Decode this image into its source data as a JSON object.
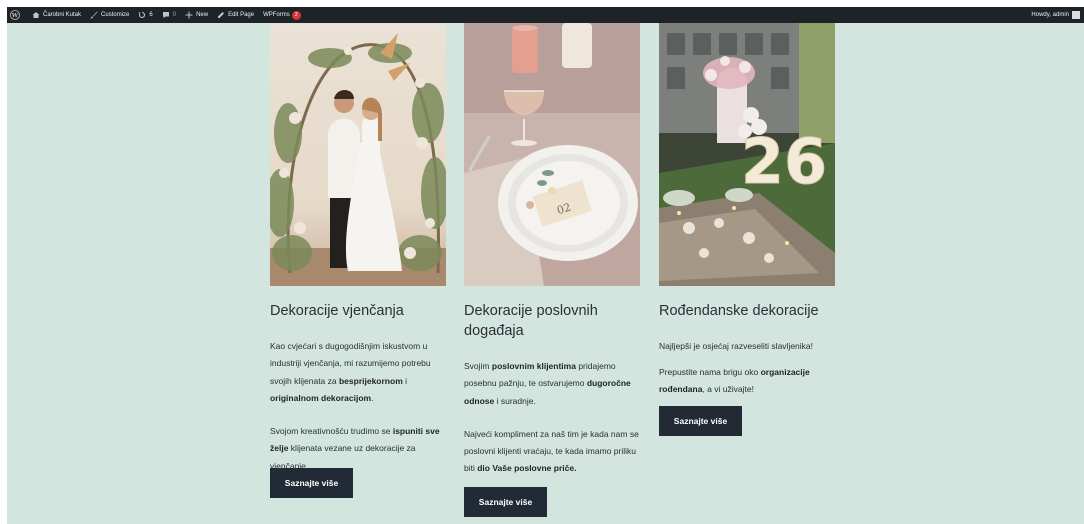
{
  "adminbar": {
    "site_name": "Čarobni Kutak",
    "customize": "Customize",
    "updates_count": "6",
    "comments_count": "0",
    "new": "New",
    "edit_page": "Edit Page",
    "wpforms": "WPForms",
    "wpforms_badge": "2",
    "howdy": "Howdy, admin"
  },
  "cards": [
    {
      "title": "Dekoracije vjenčanja",
      "p1_a": "Kao cvjećari s dugogodišnjim iskustvom u industriji vjenčanja, mi razumijemo potrebu svojih klijenata za ",
      "p1_b1": "besprijekornom",
      "p1_c": " i ",
      "p1_b2": "originalnom dekoracijom",
      "p1_d": ".",
      "p2_a": "Svojom kreativnošću trudimo se ",
      "p2_b": "ispuniti sve želje",
      "p2_c": " klijenata vezane uz dekoracije za vjenčanje.",
      "button": "Saznajte više"
    },
    {
      "title": "Dekoracije poslovnih događaja",
      "p1_a": "Svojim ",
      "p1_b1": "poslovnim klijentima",
      "p1_c": " pridajemo posebnu pažnju, te ostvarujemo ",
      "p1_b2": "dugoročne odnose",
      "p1_d": " i suradnje.",
      "p2_a": "Najveći kompliment za naš tim je kada nam se poslovni klijenti vraćaju, te kada imamo priliku biti ",
      "p2_b": "dio Vaše poslovne priče.",
      "p2_c": "",
      "button": "Saznajte više"
    },
    {
      "title": "Rođendanske dekoracije",
      "p1_a": "Najljepši je osjećaj razveseliti slavljenika!",
      "p2_a": "Prepustite nama brigu oko ",
      "p2_b": "organizacije rođendana",
      "p2_c": ", a vi uživajte!",
      "button": "Saznajte više",
      "number": "26"
    }
  ],
  "colors": {
    "background": "#d3e5df",
    "button": "#222a36",
    "adminbar": "#1d2327"
  }
}
